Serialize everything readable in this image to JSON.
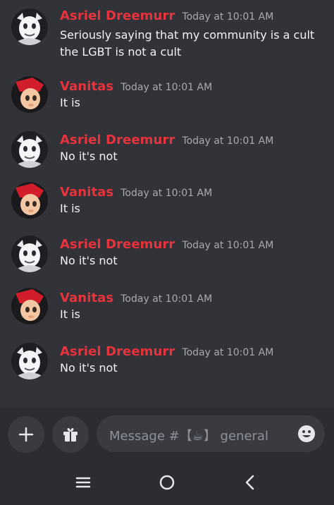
{
  "messages": [
    {
      "author": "Asriel Dreemurr",
      "timestamp": "Today at 10:01 AM",
      "text": "Seriously saying that my community is a cult the LGBT is not a cult",
      "avatar": "goat-avatar"
    },
    {
      "author": "Vanitas",
      "timestamp": "Today at 10:01 AM",
      "text": "It is",
      "avatar": "pony-avatar"
    },
    {
      "author": "Asriel Dreemurr",
      "timestamp": "Today at 10:01 AM",
      "text": "No it's not",
      "avatar": "goat-avatar"
    },
    {
      "author": "Vanitas",
      "timestamp": "Today at 10:01 AM",
      "text": "It is",
      "avatar": "pony-avatar"
    },
    {
      "author": "Asriel Dreemurr",
      "timestamp": "Today at 10:01 AM",
      "text": "No it's not",
      "avatar": "goat-avatar"
    },
    {
      "author": "Vanitas",
      "timestamp": "Today at 10:01 AM",
      "text": "It is",
      "avatar": "pony-avatar"
    },
    {
      "author": "Asriel Dreemurr",
      "timestamp": "Today at 10:01 AM",
      "text": "No it's not",
      "avatar": "goat-avatar"
    }
  ],
  "composer": {
    "placeholder": "Message #【☕】 general",
    "add_icon": "plus-icon",
    "gift_icon": "gift-icon",
    "emoji_icon": "emoji-icon"
  },
  "navbar": {
    "icons": [
      "recent-apps-icon",
      "home-icon",
      "back-icon"
    ]
  },
  "colors": {
    "background": "#313338",
    "username": "#e8333c",
    "timestamp": "#a7aab0",
    "message_text": "#f2f3f5",
    "composer_bg": "#2b2d31",
    "button_bg": "#393b41"
  }
}
